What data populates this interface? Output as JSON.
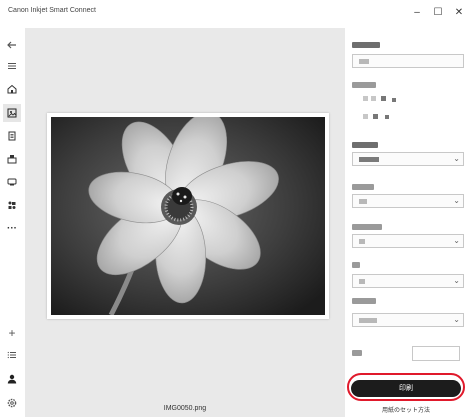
{
  "window": {
    "title": "Canon Inkjet Smart Connect",
    "minimize_glyph": "–",
    "maximize_glyph": "☐",
    "close_glyph": "✕"
  },
  "sidebar": {
    "top_items": [
      {
        "icon": "back-arrow-icon"
      },
      {
        "icon": "menu-icon"
      },
      {
        "icon": "home-icon"
      },
      {
        "icon": "photo-print-icon",
        "selected": true
      },
      {
        "icon": "document-print-icon"
      },
      {
        "icon": "scan-icon"
      },
      {
        "icon": "printer-status-icon"
      },
      {
        "icon": "copy-icon"
      },
      {
        "icon": "more-icon",
        "glyph": "···"
      }
    ],
    "bottom_items": [
      {
        "icon": "add-icon",
        "glyph": "+"
      },
      {
        "icon": "list-icon"
      },
      {
        "icon": "account-icon"
      },
      {
        "icon": "settings-icon"
      }
    ]
  },
  "preview": {
    "filename": "IMG0050.png"
  },
  "settings": {
    "print_label": "印刷",
    "paper_setting_link": "用紙のセット方法"
  },
  "colors": {
    "highlight": "#e0192b",
    "print_button": "#1c1c1c",
    "preview_bg": "#e9e9e9"
  }
}
